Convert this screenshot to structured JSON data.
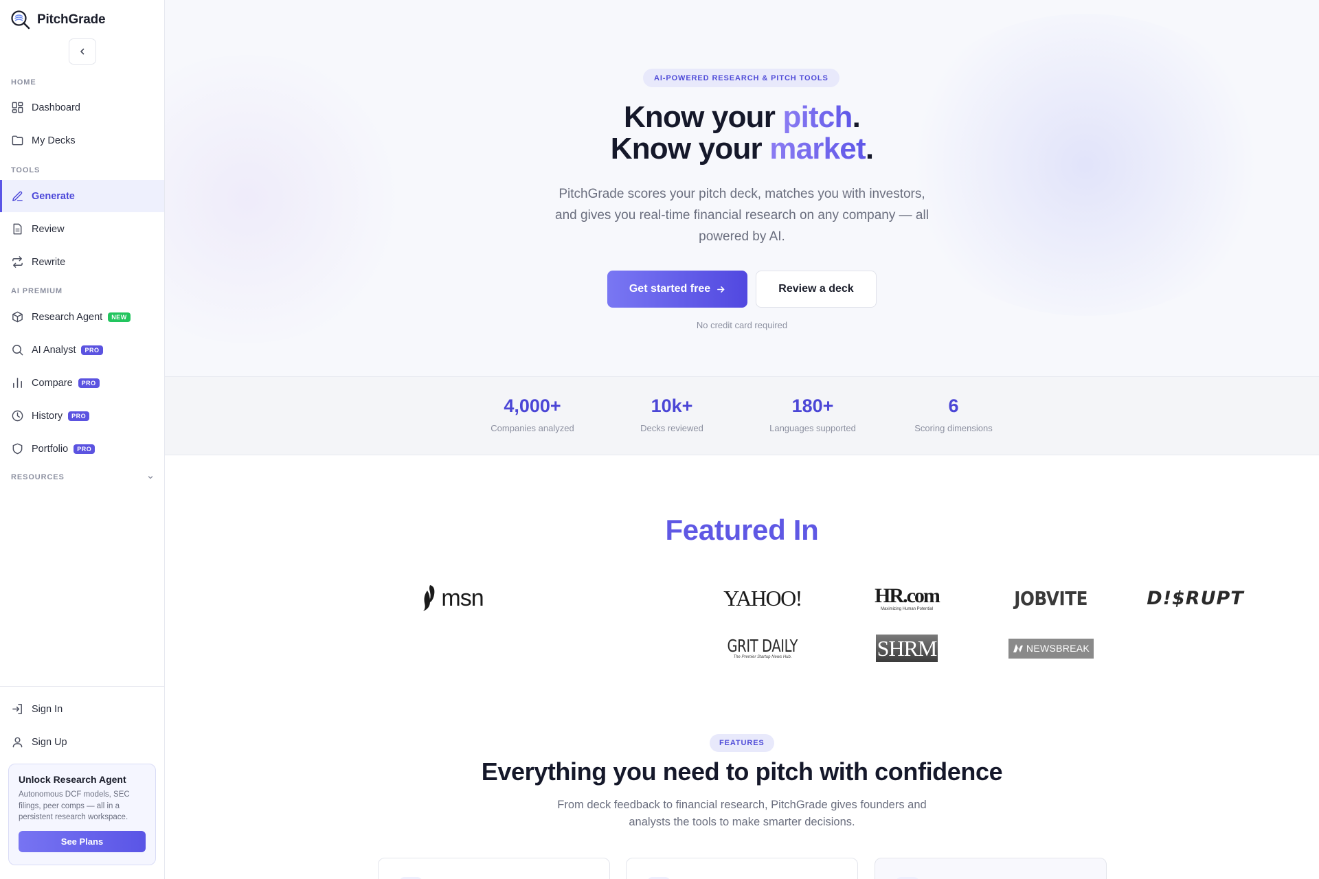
{
  "app": {
    "name": "PitchGrade"
  },
  "sidebar": {
    "sections": {
      "home": "HOME",
      "tools": "TOOLS",
      "ai_premium": "AI PREMIUM",
      "resources": "RESOURCES"
    },
    "home_items": [
      {
        "label": "Dashboard",
        "icon": "grid-icon"
      },
      {
        "label": "My Decks",
        "icon": "folder-icon"
      }
    ],
    "tool_items": [
      {
        "label": "Generate",
        "icon": "pencil-icon",
        "active": true
      },
      {
        "label": "Review",
        "icon": "document-icon"
      },
      {
        "label": "Rewrite",
        "icon": "repeat-icon"
      }
    ],
    "premium_items": [
      {
        "label": "Research Agent",
        "icon": "cube-icon",
        "badge": "NEW"
      },
      {
        "label": "AI Analyst",
        "icon": "search-icon",
        "badge": "PRO"
      },
      {
        "label": "Compare",
        "icon": "bar-chart-icon",
        "badge": "PRO"
      },
      {
        "label": "History",
        "icon": "clock-icon",
        "badge": "PRO"
      },
      {
        "label": "Portfolio",
        "icon": "shield-icon",
        "badge": "PRO"
      }
    ],
    "account_items": [
      {
        "label": "Sign In",
        "icon": "sign-in-icon"
      },
      {
        "label": "Sign Up",
        "icon": "user-icon"
      }
    ],
    "unlock_card": {
      "title": "Unlock Research Agent",
      "description": "Autonomous DCF models, SEC filings, peer comps — all in a persistent research workspace.",
      "button": "See Plans"
    }
  },
  "hero": {
    "pill": "AI-POWERED RESEARCH & PITCH TOOLS",
    "line1_prefix": "Know your ",
    "line1_highlight": "pitch",
    "line2_prefix": "Know your ",
    "line2_highlight": "market",
    "period": ".",
    "subtitle": "PitchGrade scores your pitch deck, matches you with investors, and gives you real-time financial research on any company — all powered by AI.",
    "primary_button": "Get started free",
    "secondary_button": "Review a deck",
    "note": "No credit card required"
  },
  "stats": [
    {
      "value": "4,000+",
      "label": "Companies analyzed"
    },
    {
      "value": "10k+",
      "label": "Decks reviewed"
    },
    {
      "value": "180+",
      "label": "Languages supported"
    },
    {
      "value": "6",
      "label": "Scoring dimensions"
    }
  ],
  "featured": {
    "title": "Featured In",
    "logos": [
      "msn",
      "YAHOO!",
      "HR.com",
      "JOBVITE",
      "D!$RUPT",
      "GRIT DAILY",
      "SHRM",
      "NEWSBREAK"
    ],
    "logo_taglines": {
      "hr": "Maximizing Human Potential",
      "grit": "The Premier Startup News Hub."
    }
  },
  "features": {
    "pill": "FEATURES",
    "title": "Everything you need to pitch with confidence",
    "subtitle": "From deck feedback to financial research, PitchGrade gives founders and analysts the tools to make smarter decisions."
  },
  "colors": {
    "accent": "#5a55e6",
    "accent_light": "#eef0fd",
    "badge_new": "#22c55e",
    "badge_pro": "#5b53e0"
  }
}
